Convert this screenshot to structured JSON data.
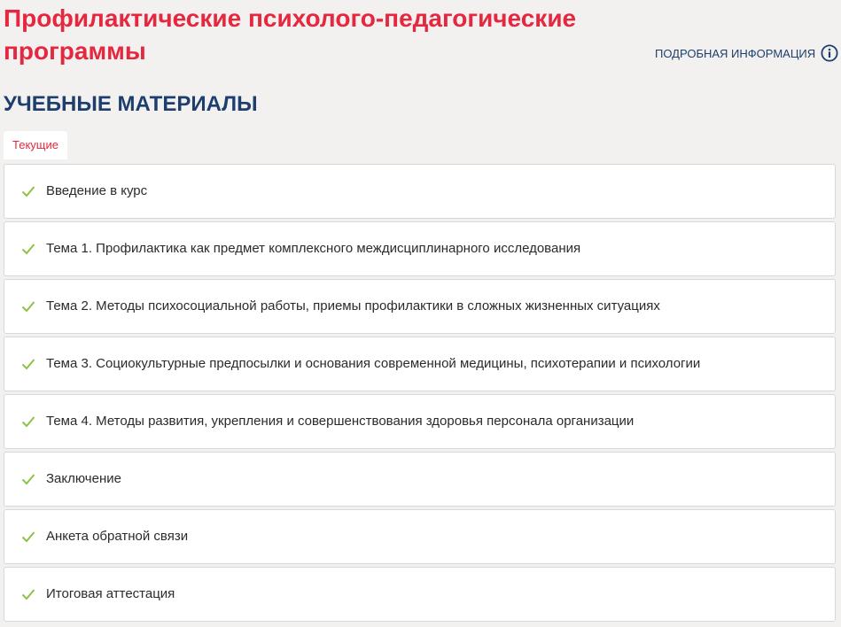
{
  "course": {
    "title": "Профилактические психолого-педагогические программы"
  },
  "header": {
    "more_info_label": "ПОДРОБНАЯ ИНФОРМАЦИЯ",
    "more_info_icon": "info-circle-icon"
  },
  "section": {
    "title": "УЧЕБНЫЕ МАТЕРИАЛЫ"
  },
  "tabs": [
    {
      "label": "Текущие",
      "active": true
    }
  ],
  "materials": [
    {
      "label": "Введение в курс",
      "status_icon": "check-icon",
      "completed": true
    },
    {
      "label": "Тема 1. Профилактика как предмет комплексного междисциплинарного исследования",
      "status_icon": "check-icon",
      "completed": true
    },
    {
      "label": "Тема 2. Методы психосоциальной работы, приемы профилактики в сложных жизненных ситуациях",
      "status_icon": "check-icon",
      "completed": true
    },
    {
      "label": "Тема 3. Социокультурные предпосылки и основания современной медицины, психотерапии и психологии",
      "status_icon": "check-icon",
      "completed": true
    },
    {
      "label": "Тема 4. Методы развития, укрепления и совершенствования здоровья персонала организации",
      "status_icon": "check-icon",
      "completed": true
    },
    {
      "label": "Заключение",
      "status_icon": "check-icon",
      "completed": true
    },
    {
      "label": "Анкета обратной связи",
      "status_icon": "check-icon",
      "completed": true
    },
    {
      "label": "Итоговая аттестация",
      "status_icon": "check-icon",
      "completed": true
    }
  ],
  "colors": {
    "title_red": "#e5283f",
    "navy": "#1e3e6d",
    "check_green": "#8bc34a",
    "background": "#f2f1ef"
  }
}
